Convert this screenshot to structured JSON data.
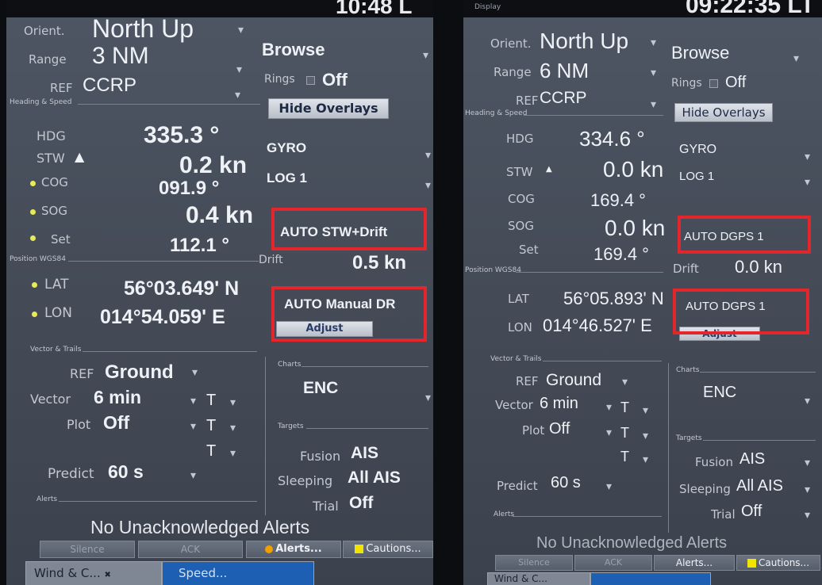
{
  "left": {
    "top_clock": "10:48 L",
    "orient_label": "Orient.",
    "orient_value": "North Up",
    "browse": "Browse",
    "range_label": "Range",
    "range_value": "3 NM",
    "rings_label": "Rings",
    "rings_value": "Off",
    "ref_label": "REF",
    "ref_value": "CCRP",
    "hide_overlays": "Hide Overlays",
    "heading_speed": "Heading & Speed",
    "hdg_label": "HDG",
    "hdg_value": "335.3 °",
    "hdg_source": "GYRO",
    "stw_label": "STW",
    "stw_value": "0.2 kn",
    "stw_source": "LOG 1",
    "cog_label": "COG",
    "cog_value": "091.9 °",
    "sog_label": "SOG",
    "sog_value": "0.4 kn",
    "sog_source": "AUTO STW+Drift",
    "set_label": "Set",
    "set_value": "112.1 °",
    "drift_label": "Drift",
    "drift_value": "0.5 kn",
    "position": "Position WGS84",
    "lat_label": "LAT",
    "lat_value": "56°03.649' N",
    "lon_label": "LON",
    "lon_value": "014°54.059' E",
    "pos_source": "AUTO Manual DR",
    "adjust": "Adjust",
    "vector_trails": "Vector & Trails",
    "vref_label": "REF",
    "vref_value": "Ground",
    "vector_label": "Vector",
    "vector_value": "6 min",
    "vector_t": "T",
    "plot_label": "Plot",
    "plot_value": "Off",
    "plot_t": "T",
    "extra_t": "T",
    "predict_label": "Predict",
    "predict_value": "60 s",
    "charts": "Charts",
    "charts_value": "ENC",
    "targets": "Targets",
    "fusion_label": "Fusion",
    "fusion_value": "AIS",
    "sleeping_label": "Sleeping",
    "sleeping_value": "All AIS",
    "trial_label": "Trial",
    "trial_value": "Off",
    "alerts": "Alerts",
    "no_alerts": "No Unacknowledged Alerts",
    "silence": "Silence",
    "ack": "ACK",
    "alerts_btn": "Alerts...",
    "cautions_btn": "Cautions...",
    "tab1": "Wind & C...",
    "tab2": "Speed..."
  },
  "right": {
    "top_clock": "09:22:35 LT",
    "display": "Display",
    "orient_label": "Orient.",
    "orient_value": "North Up",
    "browse": "Browse",
    "range_label": "Range",
    "range_value": "6 NM",
    "rings_label": "Rings",
    "rings_value": "Off",
    "ref_label": "REF",
    "ref_value": "CCRP",
    "hide_overlays": "Hide Overlays",
    "heading_speed": "Heading & Speed",
    "hdg_label": "HDG",
    "hdg_value": "334.6 °",
    "hdg_source": "GYRO",
    "stw_label": "STW",
    "stw_value": "0.0 kn",
    "stw_source": "LOG 1",
    "cog_label": "COG",
    "cog_value": "169.4 °",
    "sog_label": "SOG",
    "sog_value": "0.0 kn",
    "sog_source": "AUTO DGPS 1",
    "set_label": "Set",
    "set_value": "169.4 °",
    "drift_label": "Drift",
    "drift_value": "0.0 kn",
    "position": "Position WGS84",
    "lat_label": "LAT",
    "lat_value": "56°05.893' N",
    "lon_label": "LON",
    "lon_value": "014°46.527' E",
    "pos_source": "AUTO DGPS 1",
    "adjust": "Adjust",
    "vector_trails": "Vector & Trails",
    "vref_label": "REF",
    "vref_value": "Ground",
    "vector_label": "Vector",
    "vector_value": "6 min",
    "vector_t": "T",
    "plot_label": "Plot",
    "plot_value": "Off",
    "plot_t": "T",
    "extra_t": "T",
    "predict_label": "Predict",
    "predict_value": "60 s",
    "charts": "Charts",
    "charts_value": "ENC",
    "targets": "Targets",
    "fusion_label": "Fusion",
    "fusion_value": "AIS",
    "sleeping_label": "Sleeping",
    "sleeping_value": "All AIS",
    "trial_label": "Trial",
    "trial_value": "Off",
    "alerts": "Alerts",
    "no_alerts": "No Unacknowledged Alerts",
    "silence": "Silence",
    "ack": "ACK",
    "alerts_btn": "Alerts...",
    "cautions_btn": "Cautions...",
    "tab1": "Wind & C..."
  },
  "colors": {
    "highlight": "#e2262c",
    "indicator_dot": "#e6ea5c",
    "caution_square": "#f1e400",
    "warning_dot": "#f2a000",
    "active_tab": "#1c5fb3"
  }
}
